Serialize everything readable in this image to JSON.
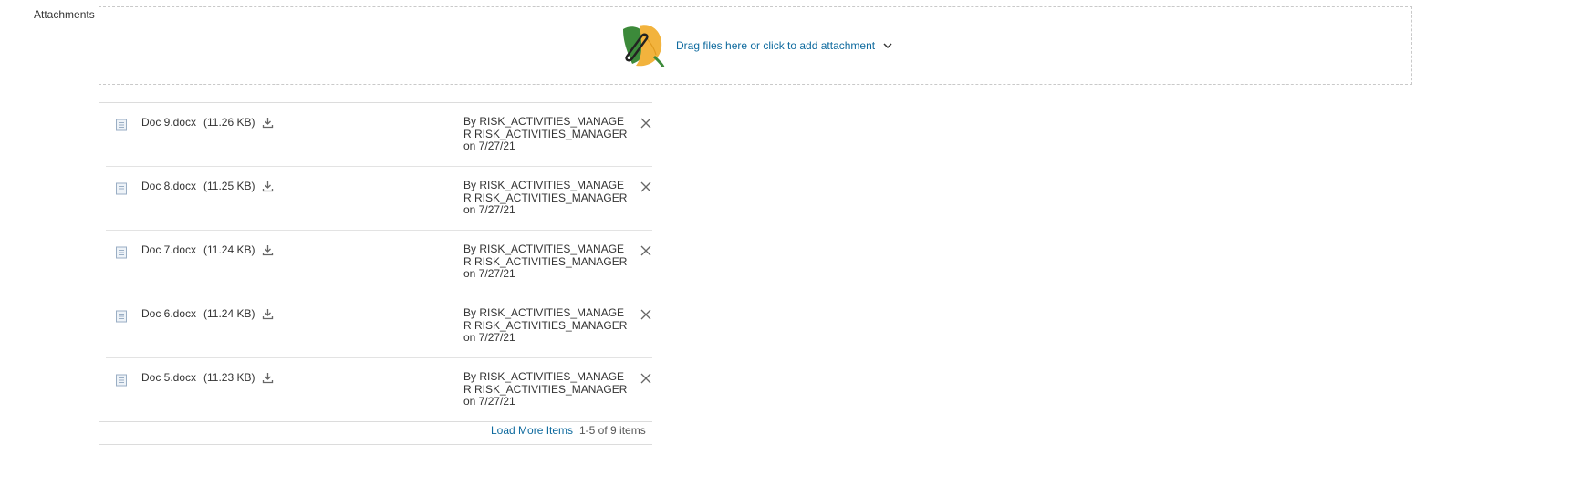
{
  "field_label": "Attachments",
  "dropzone": {
    "text": "Drag files here or click to add attachment",
    "icon": "paperclip-leaf-icon",
    "chevron": "chevron-down-icon"
  },
  "attachments": [
    {
      "name": "Doc 9.docx",
      "size": "(11.26 KB)",
      "by": "By RISK_ACTIVITIES_MANAGER RISK_ACTIVITIES_MANAGER on 7/27/21"
    },
    {
      "name": "Doc 8.docx",
      "size": "(11.25 KB)",
      "by": "By RISK_ACTIVITIES_MANAGER RISK_ACTIVITIES_MANAGER on 7/27/21"
    },
    {
      "name": "Doc 7.docx",
      "size": "(11.24 KB)",
      "by": "By RISK_ACTIVITIES_MANAGER RISK_ACTIVITIES_MANAGER on 7/27/21"
    },
    {
      "name": "Doc 6.docx",
      "size": "(11.24 KB)",
      "by": "By RISK_ACTIVITIES_MANAGER RISK_ACTIVITIES_MANAGER on 7/27/21"
    },
    {
      "name": "Doc 5.docx",
      "size": "(11.23 KB)",
      "by": "By RISK_ACTIVITIES_MANAGER RISK_ACTIVITIES_MANAGER on 7/27/21"
    }
  ],
  "footer": {
    "load_more": "Load More Items",
    "count": "1-5 of 9 items"
  },
  "colors": {
    "link": "#0e6a9e",
    "leaf_green": "#3c8a3a",
    "leaf_orange": "#f2b33d"
  }
}
